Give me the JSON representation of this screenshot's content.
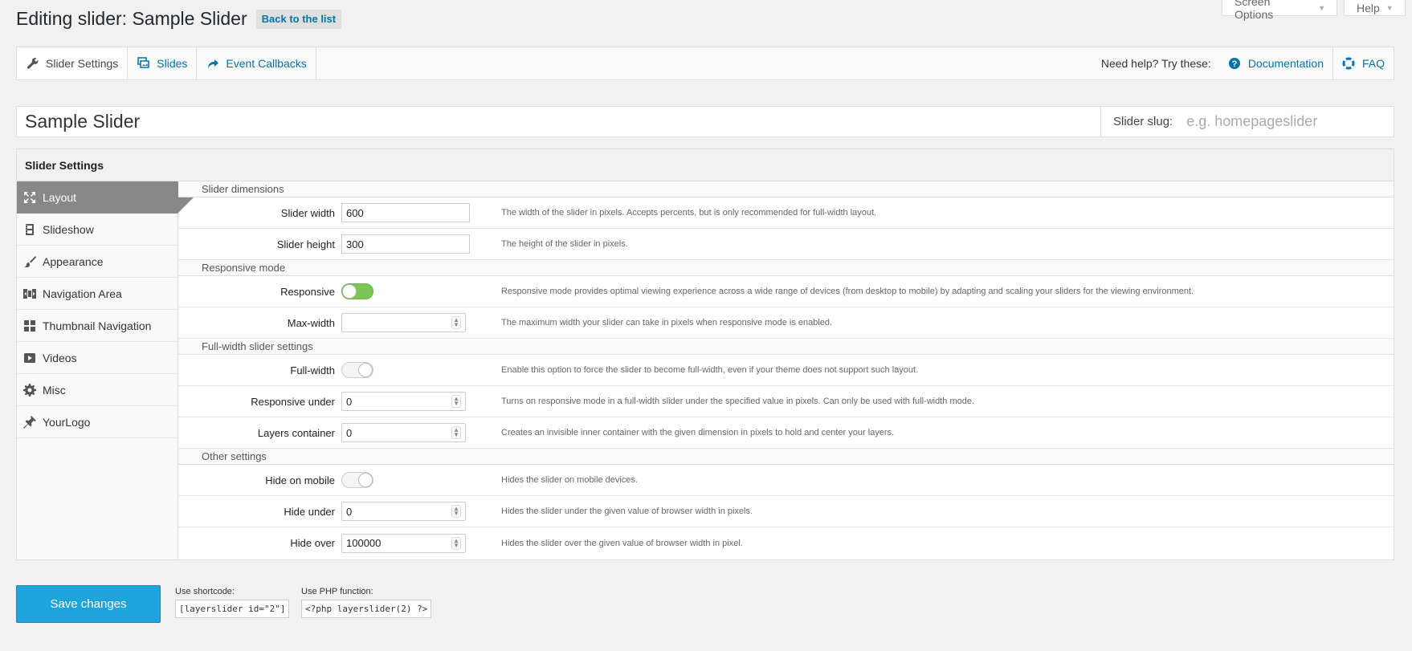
{
  "screen_meta": {
    "screen_options_label": "Screen Options",
    "help_label": "Help"
  },
  "header": {
    "title": "Editing slider: Sample Slider",
    "back_label": "Back to the list"
  },
  "tabs": {
    "slider_settings": "Slider Settings",
    "slides": "Slides",
    "event_callbacks": "Event Callbacks",
    "help_prompt": "Need help? Try these:",
    "documentation": "Documentation",
    "faq": "FAQ"
  },
  "slider": {
    "name": "Sample Slider",
    "slug_label": "Slider slug:",
    "slug_placeholder": "e.g. homepageslider"
  },
  "settings": {
    "heading": "Slider Settings",
    "nav": [
      {
        "label": "Layout",
        "icon": "resize-icon"
      },
      {
        "label": "Slideshow",
        "icon": "film-icon"
      },
      {
        "label": "Appearance",
        "icon": "brush-icon"
      },
      {
        "label": "Navigation Area",
        "icon": "navigation-icon"
      },
      {
        "label": "Thumbnail Navigation",
        "icon": "grid-icon"
      },
      {
        "label": "Videos",
        "icon": "video-icon"
      },
      {
        "label": "Misc",
        "icon": "gear-icon"
      },
      {
        "label": "YourLogo",
        "icon": "pin-icon"
      }
    ],
    "sections": {
      "dimensions": "Slider dimensions",
      "responsive": "Responsive mode",
      "fullwidth": "Full-width slider settings",
      "other": "Other settings"
    },
    "fields": {
      "width": {
        "label": "Slider width",
        "value": "600",
        "desc": "The width of the slider in pixels. Accepts percents, but is only recommended for full-width layout."
      },
      "height": {
        "label": "Slider height",
        "value": "300",
        "desc": "The height of the slider in pixels."
      },
      "responsive": {
        "label": "Responsive",
        "enabled": true,
        "desc": "Responsive mode provides optimal viewing experience across a wide range of devices (from desktop to mobile) by adapting and scaling your sliders for the viewing environment."
      },
      "maxwidth": {
        "label": "Max-width",
        "value": "",
        "desc": "The maximum width your slider can take in pixels when responsive mode is enabled."
      },
      "fullwidth": {
        "label": "Full-width",
        "enabled": false,
        "desc": "Enable this option to force the slider to become full-width, even if your theme does not support such layout."
      },
      "responsive_under": {
        "label": "Responsive under",
        "value": "0",
        "desc": "Turns on responsive mode in a full-width slider under the specified value in pixels. Can only be used with full-width mode."
      },
      "layers_container": {
        "label": "Layers container",
        "value": "0",
        "desc": "Creates an invisible inner container with the given dimension in pixels to hold and center your layers."
      },
      "hide_mobile": {
        "label": "Hide on mobile",
        "enabled": false,
        "desc": "Hides the slider on mobile devices."
      },
      "hide_under": {
        "label": "Hide under",
        "value": "0",
        "desc": "Hides the slider under the given value of browser width in pixels."
      },
      "hide_over": {
        "label": "Hide over",
        "value": "100000",
        "desc": "Hides the slider over the given value of browser width in pixel."
      }
    }
  },
  "footer": {
    "save_label": "Save changes",
    "shortcode_label": "Use shortcode:",
    "shortcode_value": "[layerslider id=\"2\"]",
    "php_label": "Use PHP function:",
    "php_value": "<?php layerslider(2) ?>"
  },
  "colors": {
    "accent": "#0073aa",
    "save_button": "#1ea3dc",
    "toggle_on": "#7ac553",
    "active_nav": "#888888"
  }
}
